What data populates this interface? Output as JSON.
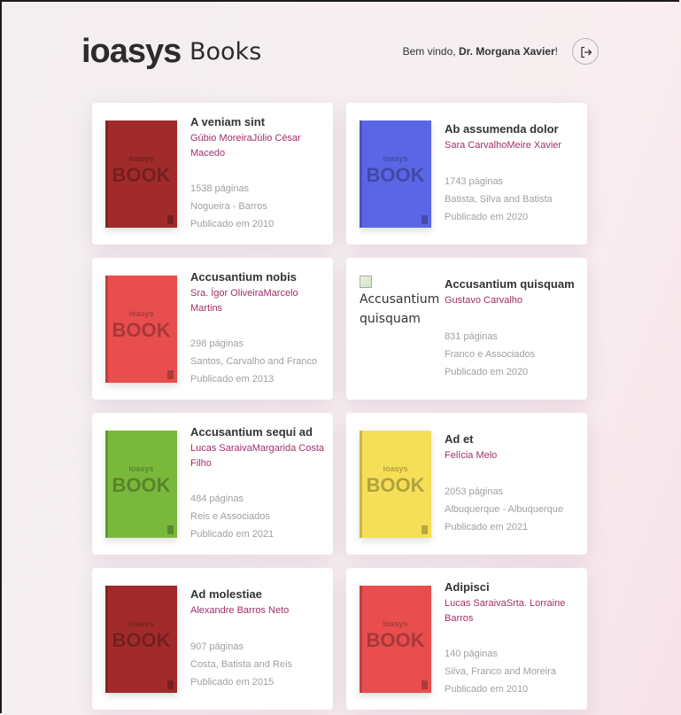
{
  "header": {
    "logo": "ioasys",
    "logo_suffix": "Books",
    "welcome_prefix": "Bem vindo, ",
    "user_name": "Dr. Morgana Xavier",
    "welcome_suffix": "!",
    "logout_icon": "logout-icon"
  },
  "cover": {
    "brand": "ioasys",
    "word": "BOOK"
  },
  "books": [
    {
      "title": "A veniam sint",
      "authors": "Gúbio MoreiraJúlio César Macedo",
      "pages": "1538 páginas",
      "publisher": "Nogueira - Barros",
      "published": "Publicado em 2010",
      "cover_color": "#a12b2b"
    },
    {
      "title": "Ab assumenda dolor",
      "authors": "Sara CarvalhoMeire Xavier",
      "pages": "1743 páginas",
      "publisher": "Batista, Silva and Batista",
      "published": "Publicado em 2020",
      "cover_color": "#5b66e6"
    },
    {
      "title": "Accusantium nobis",
      "authors": "Sra. Ígor OliveiraMarcelo Martins",
      "pages": "298 páginas",
      "publisher": "Santos, Carvalho and Franco",
      "published": "Publicado em 2013",
      "cover_color": "#e84e4e"
    },
    {
      "title": "Accusantium quisquam",
      "authors": "Gustavo Carvalho",
      "pages": "831 páginas",
      "publisher": "Franco e Associados",
      "published": "Publicado em 2020",
      "cover_alt": "Accusantium quisquam"
    },
    {
      "title": "Accusantium sequi ad",
      "authors": "Lucas SaraivaMargarida Costa Filho",
      "pages": "484 páginas",
      "publisher": "Reis e Associados",
      "published": "Publicado em 2021",
      "cover_color": "#7ab83b"
    },
    {
      "title": "Ad et",
      "authors": "Felícia Melo",
      "pages": "2053 páginas",
      "publisher": "Albuquerque - Albuquerque",
      "published": "Publicado em 2021",
      "cover_color": "#f5df57"
    },
    {
      "title": "Ad molestiae",
      "authors": "Alexandre Barros Neto",
      "pages": "907 páginas",
      "publisher": "Costa, Batista and Reis",
      "published": "Publicado em 2015",
      "cover_color": "#a12b2b"
    },
    {
      "title": "Adipisci",
      "authors": "Lucas SaraivaSrta. Lorraine Barros",
      "pages": "140 páginas",
      "publisher": "Silva, Franco and Moreira",
      "published": "Publicado em 2010",
      "cover_color": "#e84e4e"
    }
  ]
}
